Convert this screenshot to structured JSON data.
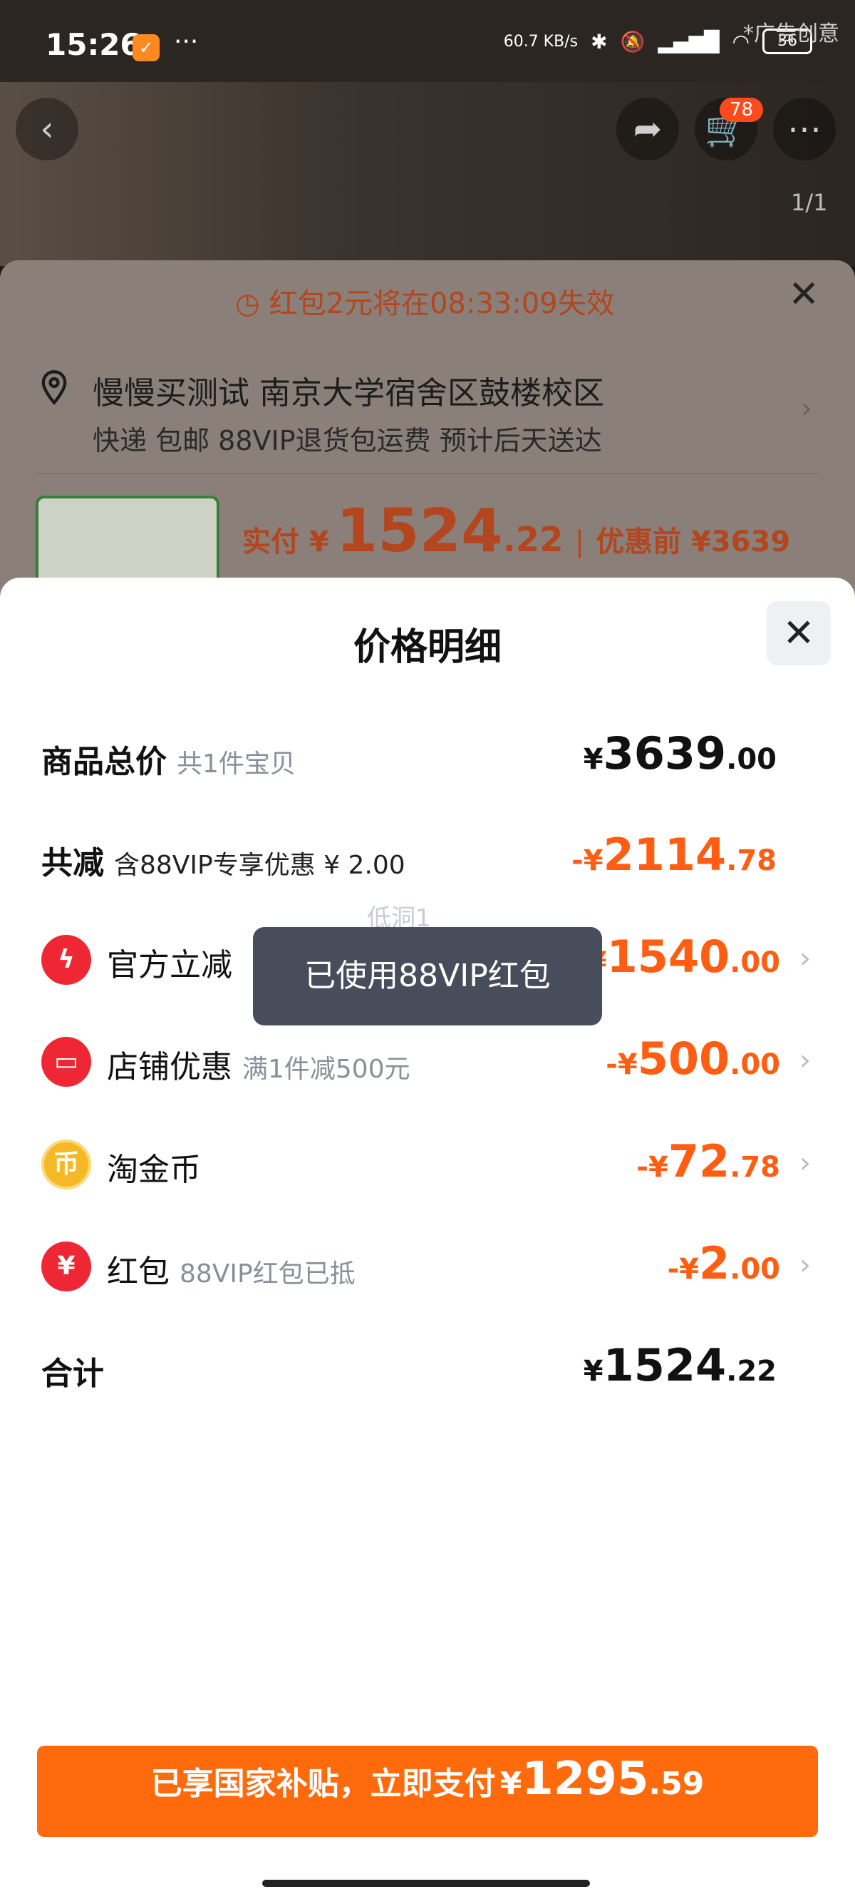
{
  "status_bar": {
    "time": "15:26",
    "app_icon": "taobao-app-icon",
    "dots": "···",
    "network_speed": "60.7 KB/s",
    "battery": "36",
    "ad_tag": "*广告创意"
  },
  "product_header": {
    "cart_count": "78",
    "image_counter": "1/1"
  },
  "order_sheet": {
    "expiry_notice": "红包2元将在08:33:09失效",
    "address": "慢慢买测试 南京大学宿舍区鼓楼校区",
    "delivery": "快递 包邮 88VIP退货包运费 预计后天送达",
    "paid_label": "实付 ¥",
    "paid_int": "1524",
    "paid_dec": ".22",
    "paid_separator": "|",
    "before_discount": "优惠前 ¥3639"
  },
  "price_detail": {
    "title": "价格明细",
    "rows": [
      {
        "label": "商品总价",
        "sub": "共1件宝贝",
        "currency": "¥",
        "int": "3639",
        "dec": ".00"
      },
      {
        "label": "共减",
        "sub": "含88VIP专享优惠 ¥ 2.00",
        "currency": "-¥",
        "int": "2114",
        "dec": ".78"
      },
      {
        "label": "官方立减",
        "sub": "",
        "currency": "-¥",
        "int": "1540",
        "dec": ".00"
      },
      {
        "label": "店铺优惠",
        "sub": "满1件减500元",
        "currency": "-¥",
        "int": "500",
        "dec": ".00"
      },
      {
        "label": "淘金币",
        "sub": "",
        "currency": "-¥",
        "int": "72",
        "dec": ".78"
      },
      {
        "label": "红包",
        "sub": "88VIP红包已抵",
        "currency": "-¥",
        "int": "2",
        "dec": ".00"
      },
      {
        "label": "合计",
        "sub": "",
        "currency": "¥",
        "int": "1524",
        "dec": ".22"
      }
    ],
    "ghost_text": "低洞1"
  },
  "toast": {
    "text": "已使用88VIP红包"
  },
  "pay_button": {
    "label": "已享国家补贴，立即支付",
    "currency": "¥",
    "int": "1295",
    "dec": ".59"
  },
  "colors": {
    "accent_orange": "#ff6a0d",
    "discount_orange": "#ff5e12",
    "icon_red": "#ef2735",
    "coin_gold": "#f5b826"
  }
}
